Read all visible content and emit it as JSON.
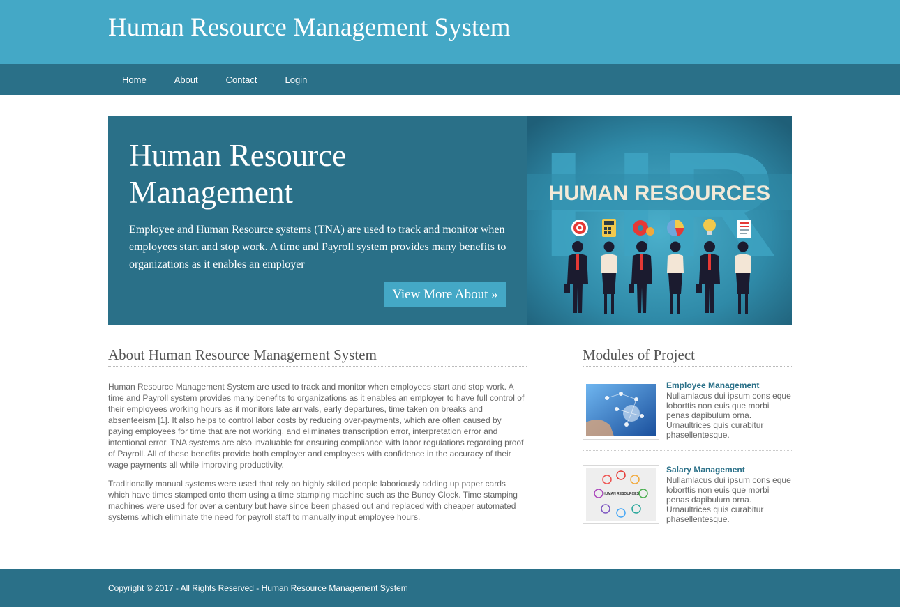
{
  "header": {
    "title": "Human Resource Management System"
  },
  "nav": {
    "items": [
      {
        "label": "Home"
      },
      {
        "label": "About"
      },
      {
        "label": "Contact"
      },
      {
        "label": "Login"
      }
    ]
  },
  "hero": {
    "title": "Human Resource Management",
    "text": "Employee and Human Resource systems (TNA) are used to track and monitor when employees start and stop work. A time and Payroll system provides many benefits to organizations as it enables an employer",
    "button_label": "View More About »",
    "image": {
      "banner_text": "HUMAN RESOURCES",
      "background_letters": "HR"
    }
  },
  "about": {
    "title": "About Human Resource Management System",
    "paragraphs": [
      "Human Resource Management System are used to track and monitor when employees start and stop work. A time and Payroll system provides many benefits to organizations as it enables an employer to have full control of their employees working hours as it monitors late arrivals, early departures, time taken on breaks and absenteeism [1]. It also helps to control labor costs by reducing over-payments, which are often caused by paying employees for time that are not working, and eliminates transcription error, interpretation error and intentional error. TNA systems are also invaluable for ensuring compliance with labor regulations regarding proof of Payroll. All of these benefits provide both employer and employees with confidence in the accuracy of their wage payments all while improving productivity.",
      "Traditionally manual systems were used that rely on highly skilled people laboriously adding up paper cards which have times stamped onto them using a time stamping machine such as the Bundy Clock. Time stamping machines were used for over a century but have since been phased out and replaced with cheaper automated systems which eliminate the need for payroll staff to manually input employee hours."
    ]
  },
  "modules": {
    "title": "Modules of Project",
    "items": [
      {
        "name": "Employee Management",
        "description": "Nullamlacus dui ipsum cons eque loborttis non euis que morbi penas dapibulum orna. Urnaultrices quis curabitur phasellentesque."
      },
      {
        "name": "Salary Management",
        "description": "Nullamlacus dui ipsum cons eque loborttis non euis que morbi penas dapibulum orna. Urnaultrices quis curabitur phasellentesque.",
        "thumb_text": "HUMAN RESOURCES"
      }
    ]
  },
  "footer": {
    "text": "Copyright © 2017 - All Rights Reserved - Human Resource Management System"
  },
  "colors": {
    "header": "#44a8c6",
    "nav": "#2a7088",
    "accent": "#44a8c6"
  }
}
